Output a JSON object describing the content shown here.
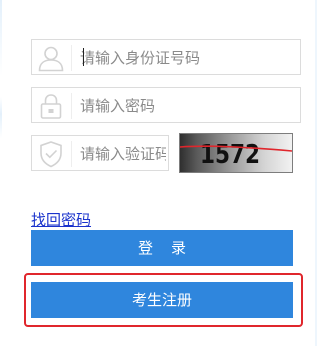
{
  "form": {
    "idcard": {
      "placeholder": "请输入身份证号码",
      "value": "",
      "icon": "user-icon"
    },
    "password": {
      "placeholder": "请输入密码",
      "value": "",
      "icon": "lock-icon"
    },
    "captcha": {
      "placeholder": "请输入验证码",
      "value": "",
      "icon": "shield-icon",
      "image_text": "1572"
    },
    "forgot_password_label": "找回密码",
    "login_label": "登录",
    "register_label": "考生注册"
  },
  "colors": {
    "primary_button": "#2f86dd",
    "link": "#1a33cc",
    "highlight_border": "#e0262c",
    "captcha_strike": "#e0262c"
  }
}
